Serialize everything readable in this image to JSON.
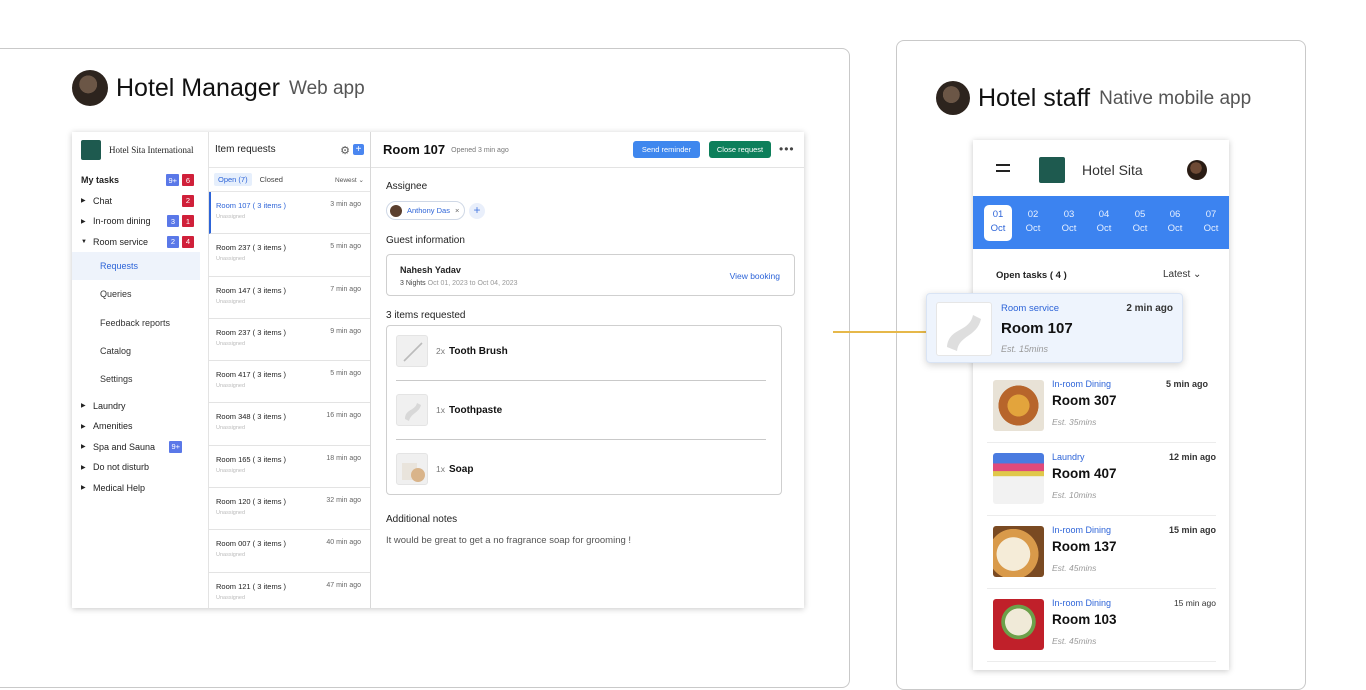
{
  "manager_header": {
    "title": "Hotel Manager",
    "subtitle": "Web app"
  },
  "staff_header": {
    "title": "Hotel staff",
    "subtitle": "Native mobile app"
  },
  "webapp": {
    "brand": "Hotel Sita International",
    "sidebar": {
      "my_tasks": {
        "label": "My tasks",
        "badges": [
          "9+",
          "6"
        ]
      },
      "items": [
        {
          "label": "Chat",
          "badges": [
            "2"
          ]
        },
        {
          "label": "In-room dining",
          "badges": [
            "3",
            "1"
          ]
        },
        {
          "label": "Room service",
          "badges": [
            "2",
            "4"
          ]
        }
      ],
      "sub_items": [
        "Requests",
        "Queries",
        "Feedback reports",
        "Catalog",
        "Settings"
      ],
      "more_items": [
        {
          "label": "Laundry",
          "badge": ""
        },
        {
          "label": "Amenities",
          "badge": ""
        },
        {
          "label": "Spa and Sauna",
          "badge": "9+"
        },
        {
          "label": "Do not disturb",
          "badge": ""
        },
        {
          "label": "Medical Help",
          "badge": ""
        }
      ]
    },
    "request_list": {
      "title": "Item requests",
      "tab_open": "Open (7)",
      "tab_closed": "Closed",
      "sort": "Newest",
      "items": [
        {
          "room": "Room 107 ( 3 items )",
          "time": "3 min ago",
          "status": "Unassigned"
        },
        {
          "room": "Room 237 ( 3 items )",
          "time": "5 min ago",
          "status": "Unassigned"
        },
        {
          "room": "Room 147 ( 3 items )",
          "time": "7 min ago",
          "status": "Unassigned"
        },
        {
          "room": "Room 237 ( 3 items )",
          "time": "9 min ago",
          "status": "Unassigned"
        },
        {
          "room": "Room 417 ( 3 items )",
          "time": "5 min ago",
          "status": "Unassigned"
        },
        {
          "room": "Room 348 ( 3 items )",
          "time": "16 min ago",
          "status": "Unassigned"
        },
        {
          "room": "Room 165 ( 3 items )",
          "time": "18 min ago",
          "status": "Unassigned"
        },
        {
          "room": "Room 120 ( 3 items )",
          "time": "32 min ago",
          "status": "Unassigned"
        },
        {
          "room": "Room 007 ( 3 items )",
          "time": "40 min ago",
          "status": "Unassigned"
        },
        {
          "room": "Room 121 ( 3 items )",
          "time": "47 min ago",
          "status": "Unassigned"
        }
      ]
    },
    "detail": {
      "room": "Room 107",
      "opened": "Opened 3 min ago",
      "send_reminder": "Send reminder",
      "close_request": "Close request",
      "more": "•••",
      "assignee_label": "Assignee",
      "assignee": "Anthony Das",
      "chip_remove": "×",
      "add": "+",
      "guest_label": "Guest information",
      "guest_name": "Nahesh Yadav",
      "nights": "3  Nights",
      "dates": "Oct 01, 2023 to Oct 04, 2023",
      "view_booking": "View booking",
      "items_label": "3 items requested",
      "items": [
        {
          "qty": "2x",
          "name": "Tooth Brush"
        },
        {
          "qty": "1x",
          "name": "Toothpaste"
        },
        {
          "qty": "1x",
          "name": "Soap"
        }
      ],
      "notes_label": "Additional notes",
      "notes": "It would be great to get a no fragrance soap for grooming !"
    }
  },
  "mobile": {
    "hotel": "Hotel Sita",
    "dates": [
      {
        "day": "01",
        "month": "Oct"
      },
      {
        "day": "02",
        "month": "Oct"
      },
      {
        "day": "03",
        "month": "Oct"
      },
      {
        "day": "04",
        "month": "Oct"
      },
      {
        "day": "05",
        "month": "Oct"
      },
      {
        "day": "06",
        "month": "Oct"
      },
      {
        "day": "07",
        "month": "Oct"
      }
    ],
    "open_tasks": "Open tasks ( 4 )",
    "sort": "Latest",
    "featured": {
      "category": "Room service",
      "room": "Room 107",
      "est": "Est. 15mins",
      "ago": "2 min ago"
    },
    "tasks": [
      {
        "category": "In-room Dining",
        "room": "Room 307",
        "est": "Est. 35mins",
        "ago": "5 min ago"
      },
      {
        "category": "Laundry",
        "room": "Room 407",
        "est": "Est. 10mins",
        "ago": "12 min ago"
      },
      {
        "category": "In-room Dining",
        "room": "Room 137",
        "est": "Est. 45mins",
        "ago": "15 min ago"
      },
      {
        "category": "In-room Dining",
        "room": "Room 103",
        "est": "Est. 45mins",
        "ago": "15 min ago"
      }
    ]
  },
  "colors": {
    "accent_blue": "#3c83f0",
    "close_green": "#0d7f5b",
    "badge_red": "#d0203a",
    "badge_blue": "#5a78e8",
    "connector": "#e6b84a"
  }
}
